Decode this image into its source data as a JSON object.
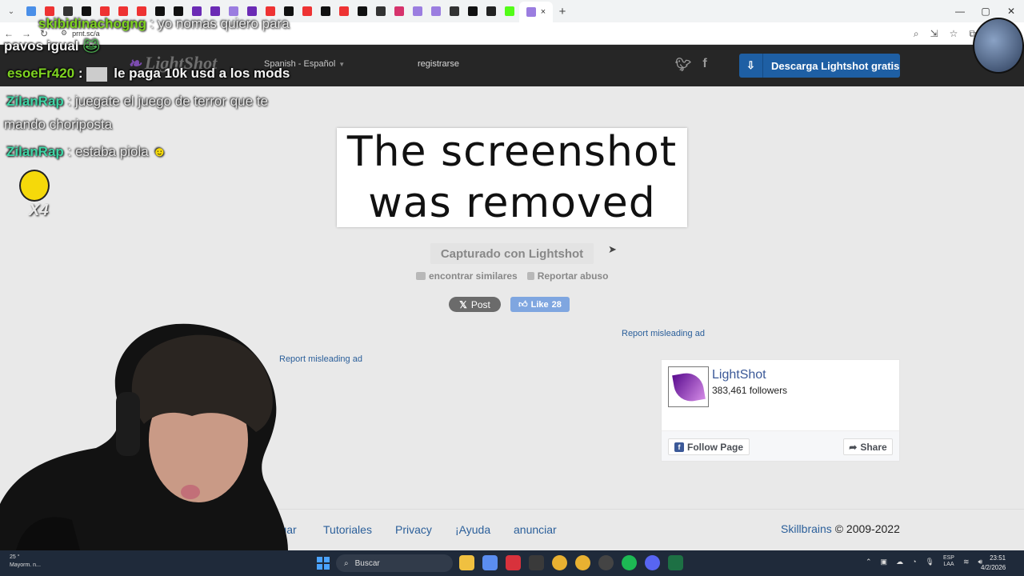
{
  "browser": {
    "url": "prnt.sc/a",
    "tab_close": "×",
    "new_tab": "+",
    "window_controls": [
      "—",
      "▢",
      "✕"
    ]
  },
  "header": {
    "logo_text": "LightShot",
    "language": "Spanish - Español",
    "register": "registrarse",
    "download_button": "Descarga Lightshot gratis",
    "social_icons": [
      "twitter-icon",
      "facebook-icon"
    ]
  },
  "main": {
    "removed_line1": "The screenshot",
    "removed_line2": "was removed",
    "captured_label": "Capturado con Lightshot",
    "find_similar": "encontrar similares",
    "report_abuse": "Reportar abuso",
    "x_post": "Post",
    "fb_like": "Like",
    "fb_like_count": "28",
    "report_ad_right": "Report misleading ad",
    "report_ad_left": "Report misleading ad"
  },
  "fb_widget": {
    "page_name": "LightShot",
    "followers": "383,461 followers",
    "follow_button": "Follow Page",
    "share_button": "Share"
  },
  "footer": {
    "links": [
      "argar",
      "Tutoriales",
      "Privacy",
      "¡Ayuda",
      "anunciar"
    ],
    "company": "Skillbrains",
    "copyright": "© 2009-2022"
  },
  "taskbar": {
    "weather_temp": "25 °",
    "weather_text": "Mayorm. n...",
    "search_placeholder": "Buscar",
    "lang_line1": "ESP",
    "lang_line2": "LAA",
    "time": "23:51",
    "date": "4/2/2026"
  },
  "stream_chat": [
    {
      "user": "skibidinachogng",
      "sep": " : ",
      "msg": "yo nomas quiero para"
    },
    {
      "user": "",
      "sep": "",
      "msg": "pavos igual"
    },
    {
      "user": "esoeFr420",
      "sep": " : ",
      "msg": "le paga 10k usd a los mods"
    },
    {
      "user": "ZilanRap",
      "sep": " : ",
      "msg": "juegate el juego de terror que te"
    },
    {
      "user": "",
      "sep": "",
      "msg": "mando choriposta"
    },
    {
      "user": "ZilanRap",
      "sep": " : ",
      "msg": "estaba piola"
    }
  ],
  "emote_multiplier": "X4"
}
